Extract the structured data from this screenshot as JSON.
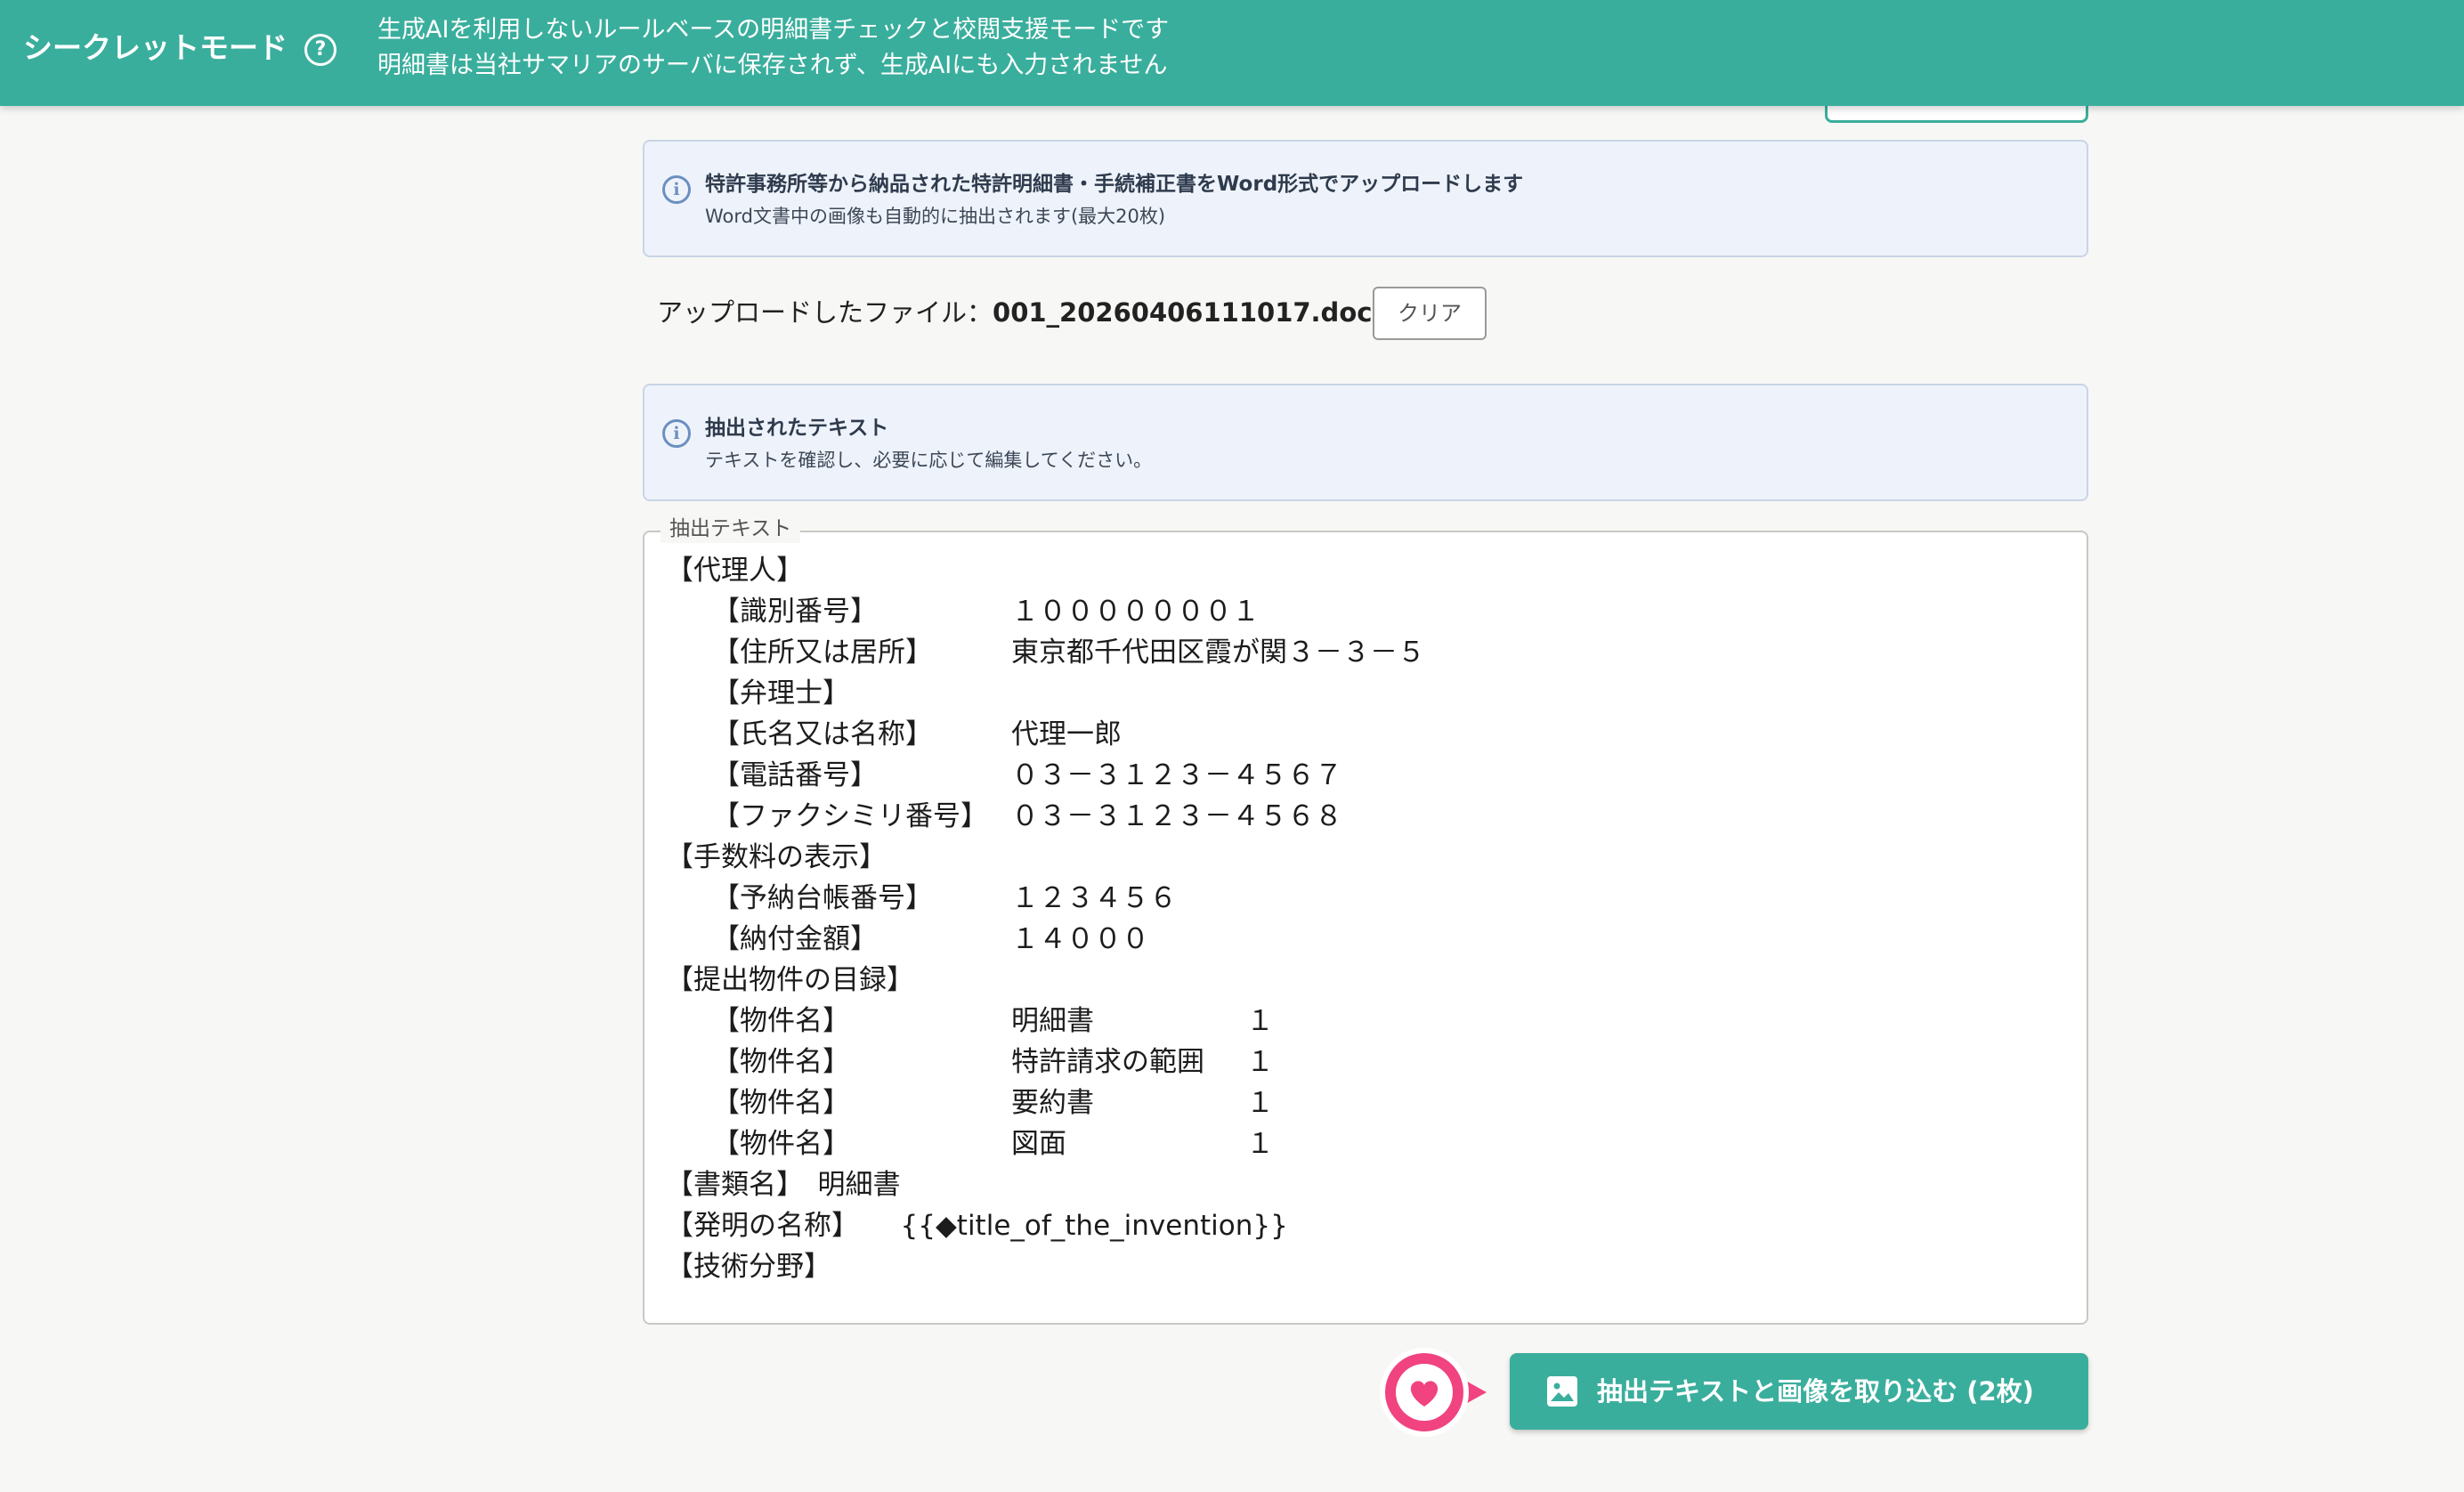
{
  "banner": {
    "title": "シークレットモード",
    "help_icon": "question-circle-icon",
    "desc_line1": "生成AIを利用しないルールベースの明細書チェックと校閲支援モードです",
    "desc_line2": "明細書は当社サマリアのサーバに保存されず、生成AIにも入力されません"
  },
  "upload_info": {
    "icon": "info-circle-icon",
    "title": "特許事務所等から納品された特許明細書・手続補正書をWord形式でアップロードします",
    "subtitle": "Word文書中の画像も自動的に抽出されます(最大20枚)"
  },
  "file": {
    "label": "アップロードしたファイル：",
    "name": "001_20260406111017.docx",
    "clear_label": "クリア"
  },
  "extracted_info": {
    "icon": "info-circle-icon",
    "title": "抽出されたテキスト",
    "subtitle": "テキストを確認し、必要に応じて編集してください。"
  },
  "extracted_text": {
    "legend": "抽出テキスト",
    "lines": [
      {
        "l1": "【代理人】"
      },
      {
        "l2": "【識別番号】",
        "v": "１０００００００１"
      },
      {
        "l2": "【住所又は居所】",
        "v": "東京都千代田区霞が関３－３－５"
      },
      {
        "l2": "【弁理士】"
      },
      {
        "l2": "【氏名又は名称】",
        "v": "代理一郎"
      },
      {
        "l2": "【電話番号】",
        "v": "０３－３１２３－４５６７"
      },
      {
        "l2": "【ファクシミリ番号】",
        "v": "０３－３１２３－４５６８"
      },
      {
        "l1": "【手数料の表示】"
      },
      {
        "l2": "【予納台帳番号】",
        "v": "１２３４５６"
      },
      {
        "l2": "【納付金額】",
        "v": "１４０００"
      },
      {
        "l1": "【提出物件の目録】"
      },
      {
        "l2": "【物件名】",
        "v": "明細書",
        "n": "１"
      },
      {
        "l2": "【物件名】",
        "v": "特許請求の範囲",
        "n": "１"
      },
      {
        "l2": "【物件名】",
        "v": "要約書",
        "n": "１"
      },
      {
        "l2": "【物件名】",
        "v": "図面",
        "n": "１"
      },
      {
        "l1": "【書類名】　明細書"
      },
      {
        "l1": "【発明の名称】　　{{◆title_of_the_invention}}"
      },
      {
        "l1": "【技術分野】"
      }
    ]
  },
  "actions": {
    "import_label": "抽出テキストと画像を取り込む (2枚)",
    "import_icon": "image-icon",
    "badge_icon": "heart-icon"
  },
  "colors": {
    "brand": "#3aae9c",
    "info_bg": "#eef3fb",
    "badge": "#f0437f"
  }
}
